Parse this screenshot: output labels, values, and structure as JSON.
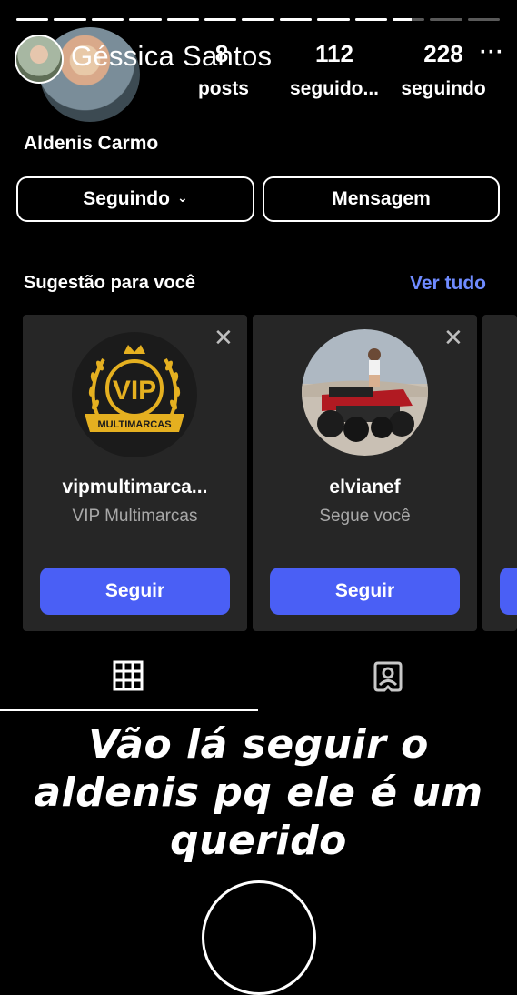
{
  "story": {
    "username": "Géssica Santos",
    "more_icon": "more-horizontal-icon",
    "segments_filled": [
      1,
      1,
      1,
      1,
      1,
      1,
      1,
      1,
      1,
      1,
      0.6,
      0,
      0
    ]
  },
  "profile": {
    "stats": [
      {
        "num": "8",
        "label": "posts"
      },
      {
        "num": "112",
        "label": "seguido..."
      },
      {
        "num": "228",
        "label": "seguindo"
      }
    ],
    "name": "Aldenis Carmo",
    "buttons": {
      "following": "Seguindo",
      "message": "Mensagem"
    }
  },
  "suggestions": {
    "title": "Sugestão para você",
    "see_all": "Ver tudo",
    "cards": [
      {
        "username": "vipmultimarca...",
        "subtitle": "VIP Multimarcas",
        "button": "Seguir"
      },
      {
        "username": "elvianef",
        "subtitle": "Segue você",
        "button": "Seguir"
      }
    ],
    "vip_logo": {
      "badge": "VIP",
      "ribbon": "MULTIMARCAS"
    }
  },
  "tabs": [
    {
      "icon": "grid-icon",
      "active": true
    },
    {
      "icon": "tagged-person-icon",
      "active": false
    }
  ],
  "caption": "Vão lá seguir o aldenis pq ele é um querido",
  "colors": {
    "accent": "#4a5ff5",
    "link": "#6f8bff",
    "card": "#262626",
    "gold": "#e5b020"
  }
}
